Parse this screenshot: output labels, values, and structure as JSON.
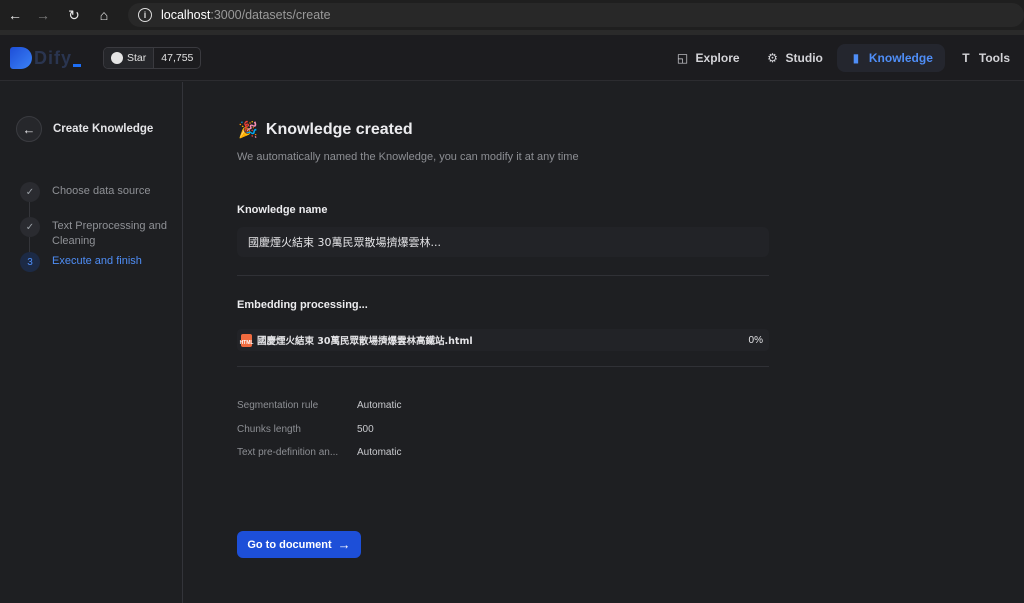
{
  "browser": {
    "url_host": "localhost",
    "url_path": ":3000/datasets/create"
  },
  "header": {
    "logo_text": "Dify",
    "github_star_label": "Star",
    "github_star_count": "47,755",
    "nav": [
      {
        "label": "Explore",
        "icon": "explore-icon"
      },
      {
        "label": "Studio",
        "icon": "studio-icon"
      },
      {
        "label": "Knowledge",
        "icon": "book-icon",
        "active": true
      },
      {
        "label": "Tools",
        "icon": "tools-icon"
      }
    ]
  },
  "sidebar": {
    "back_label": "Create Knowledge",
    "steps": [
      {
        "label": "Choose data source",
        "marker": "✓",
        "state": "done"
      },
      {
        "label": "Text Preprocessing and Cleaning",
        "marker": "✓",
        "state": "done"
      },
      {
        "label": "Execute and finish",
        "marker": "3",
        "state": "current"
      }
    ]
  },
  "main": {
    "title": "Knowledge created",
    "subtitle": "We automatically named the Knowledge, you can modify it at any time",
    "name_label": "Knowledge name",
    "name_value": "國慶煙火結束 30萬民眾散場擠爆雲林...",
    "embedding_label": "Embedding processing...",
    "file": {
      "name": "國慶煙火結束 30萬民眾散場擠爆雲林高鐵站.html",
      "progress": "0%",
      "icon_text": "HTML"
    },
    "rules": [
      {
        "key": "Segmentation rule",
        "value": "Automatic"
      },
      {
        "key": "Chunks length",
        "value": "500"
      },
      {
        "key": "Text pre-definition an...",
        "value": "Automatic"
      }
    ],
    "go_button": "Go to document"
  },
  "colors": {
    "accent": "#4f8ef7",
    "button": "#1d4fd8",
    "background": "#1e1f22"
  }
}
